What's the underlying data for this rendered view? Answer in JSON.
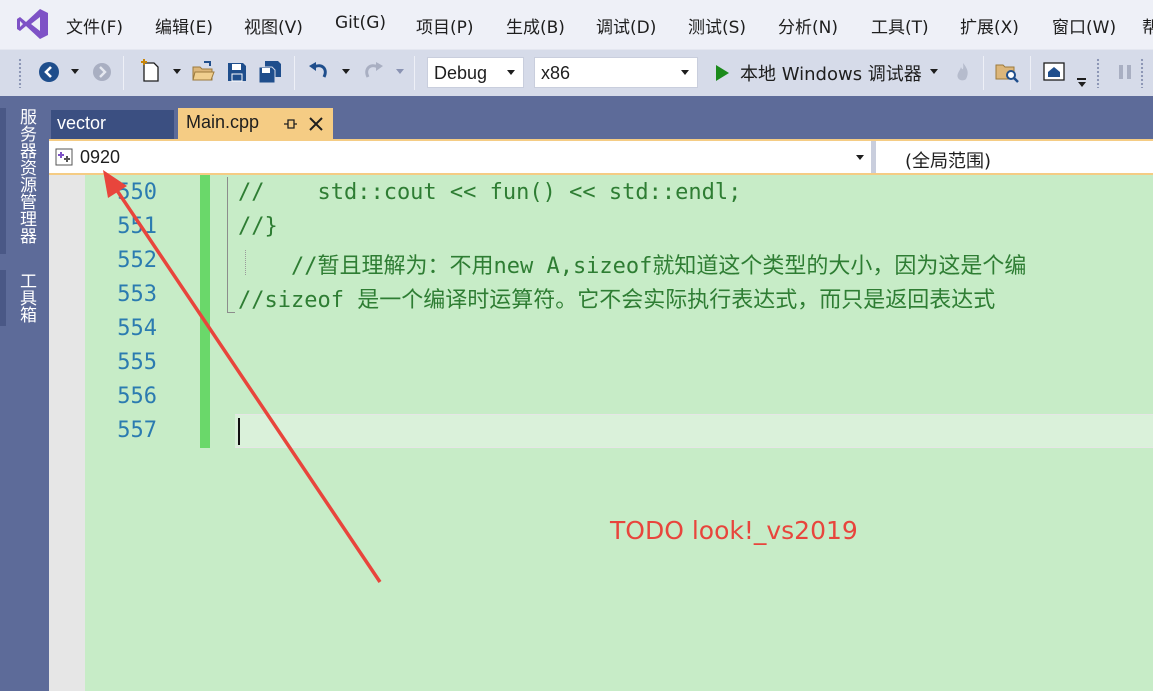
{
  "menubar": {
    "logo_icon": "visual-studio-logo-icon",
    "items": [
      {
        "label": "文件(F)"
      },
      {
        "label": "编辑(E)"
      },
      {
        "label": "视图(V)"
      },
      {
        "label": "Git(G)"
      },
      {
        "label": "项目(P)"
      },
      {
        "label": "生成(B)"
      },
      {
        "label": "调试(D)"
      },
      {
        "label": "测试(S)"
      },
      {
        "label": "分析(N)"
      },
      {
        "label": "工具(T)"
      },
      {
        "label": "扩展(X)"
      },
      {
        "label": "窗口(W)"
      },
      {
        "label": "帮"
      }
    ]
  },
  "toolbar": {
    "config": "Debug",
    "platform": "x86",
    "run_label": "本地 Windows 调试器",
    "icons": [
      "back-icon",
      "forward-icon",
      "new-project-icon",
      "open-folder-icon",
      "save-icon",
      "save-all-icon",
      "undo-icon",
      "redo-icon",
      "start-debug-icon",
      "hot-reload-icon",
      "find-in-files-icon",
      "home-icon",
      "pause-icon"
    ]
  },
  "siderail": {
    "tabs": [
      {
        "label": "服务器资源管理器"
      },
      {
        "label": "工具箱"
      }
    ]
  },
  "tabs": {
    "inactive": {
      "label": "vector"
    },
    "active": {
      "label": "Main.cpp"
    }
  },
  "navbar": {
    "project": "0920",
    "scope": "(全局范围)"
  },
  "editor": {
    "lines": [
      {
        "num": "550",
        "text": "//    std::cout << fun() << std::endl;"
      },
      {
        "num": "551",
        "text": "//}"
      },
      {
        "num": "552",
        "text": "    //暂且理解为：不用new A,sizeof就知道这个类型的大小，因为这是个编"
      },
      {
        "num": "553",
        "text": "//sizeof 是一个编译时运算符。它不会实际执行表达式，而只是返回表达式"
      },
      {
        "num": "554",
        "text": ""
      },
      {
        "num": "555",
        "text": ""
      },
      {
        "num": "556",
        "text": ""
      },
      {
        "num": "557",
        "text": ""
      }
    ],
    "annotation": "TODO look!_vs2019"
  },
  "colors": {
    "editor_background": "#c7ecc7",
    "comment": "#2e7d33",
    "line_number": "#2b7bb0",
    "active_tab": "#f5cc84",
    "annotation_arrow": "#e8453c",
    "chrome": "#5d6b99"
  }
}
